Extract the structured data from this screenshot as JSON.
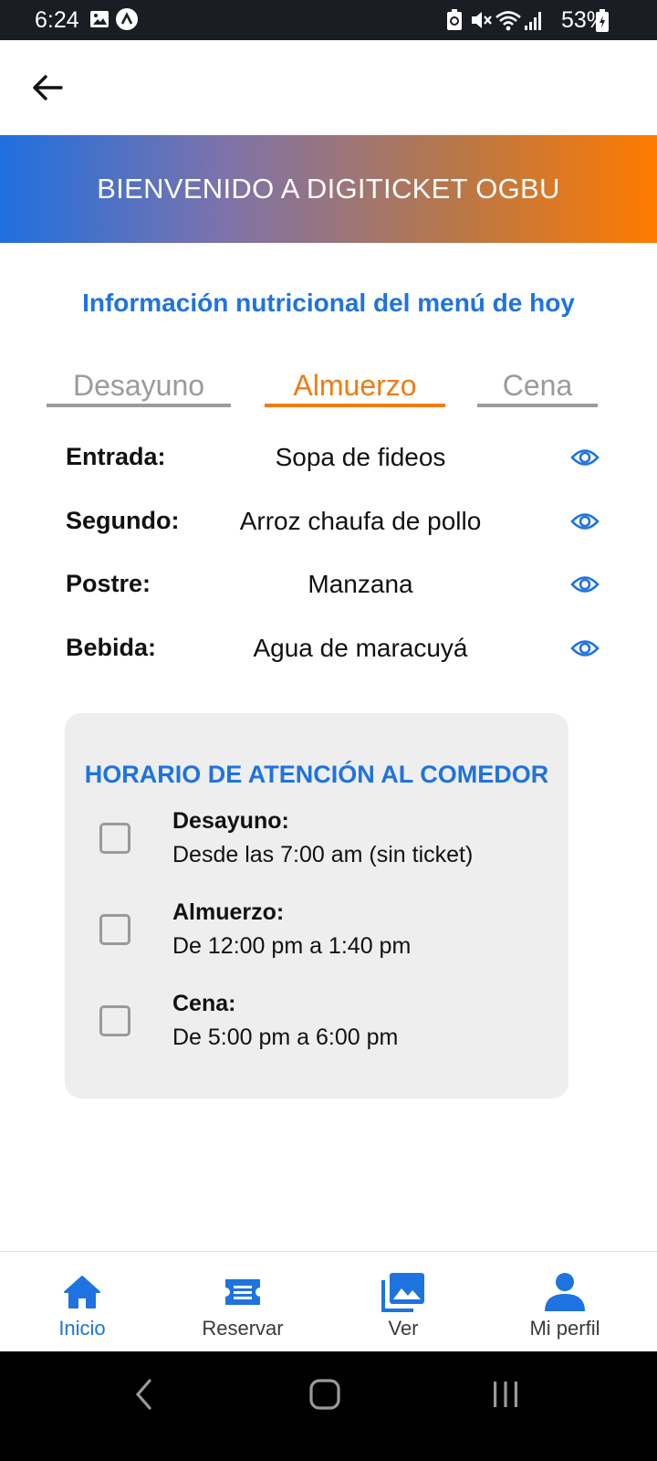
{
  "status_bar": {
    "time": "6:24",
    "battery": "53%",
    "icons": [
      "image-icon",
      "app-a-icon",
      "recycle-icon",
      "mute-icon",
      "wifi-icon",
      "signal-icon",
      "battery-icon"
    ]
  },
  "header": {
    "back_icon": "arrow-left-icon"
  },
  "banner": {
    "title": "BIENVENIDO A DIGITICKET OGBU"
  },
  "menu_section": {
    "title": "Información nutricional del menú de hoy",
    "tabs": [
      {
        "label": "Desayuno",
        "active": false
      },
      {
        "label": "Almuerzo",
        "active": true
      },
      {
        "label": "Cena",
        "active": false
      }
    ],
    "items": [
      {
        "label": "Entrada:",
        "value": "Sopa de fideos"
      },
      {
        "label": "Segundo:",
        "value": "Arroz chaufa de pollo"
      },
      {
        "label": "Postre:",
        "value": "Manzana"
      },
      {
        "label": "Bebida:",
        "value": "Agua de maracuyá"
      }
    ]
  },
  "schedule": {
    "title": "HORARIO DE ATENCIÓN AL COMEDOR",
    "items": [
      {
        "name": "Desayuno:",
        "time": "Desde las 7:00 am (sin ticket)",
        "checked": false
      },
      {
        "name": "Almuerzo:",
        "time": "De 12:00 pm a 1:40 pm",
        "checked": false
      },
      {
        "name": "Cena:",
        "time": "De 5:00 pm a 6:00 pm",
        "checked": false
      }
    ]
  },
  "bottom_nav": {
    "items": [
      {
        "label": "Inicio",
        "icon": "home-icon",
        "active": true
      },
      {
        "label": "Reservar",
        "icon": "ticket-icon",
        "active": false
      },
      {
        "label": "Ver",
        "icon": "gallery-icon",
        "active": false
      },
      {
        "label": "Mi perfil",
        "icon": "person-icon",
        "active": false
      }
    ]
  },
  "colors": {
    "accent_blue": "#1f73e0",
    "accent_orange": "#f07b12",
    "tab_inactive": "#9b9b9b",
    "card_bg": "#eeeeee"
  }
}
